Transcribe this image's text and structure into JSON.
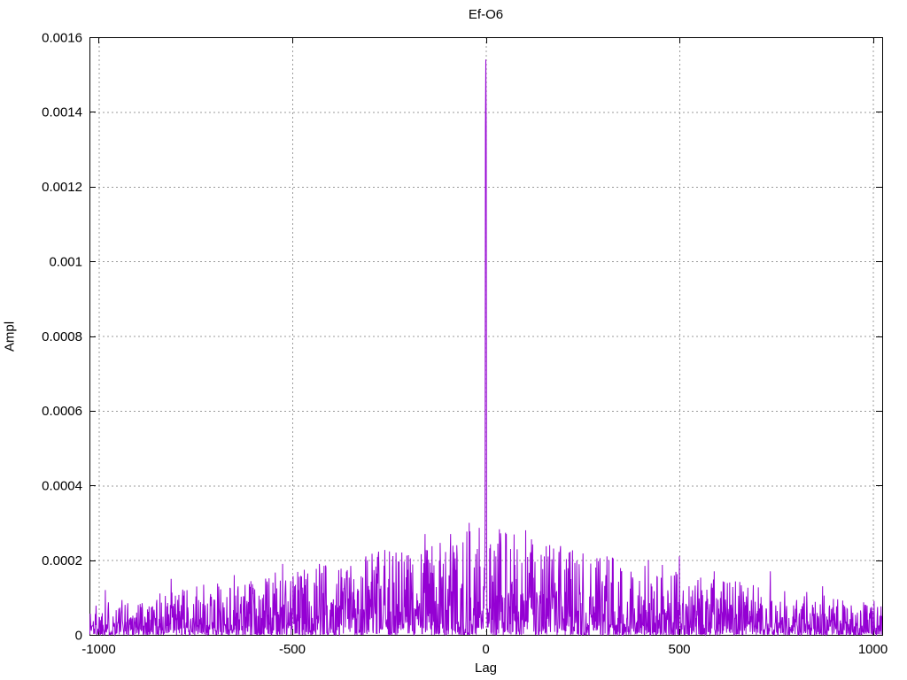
{
  "window": {
    "background": "#ffffff"
  },
  "chart_data": {
    "type": "line",
    "title": "Ef-O6",
    "xlabel": "Lag",
    "ylabel": "Ampl",
    "xlim": [
      -1024,
      1024
    ],
    "ylim": [
      0,
      0.0016
    ],
    "x_ticks": [
      {
        "value": -1000,
        "label": "-1000"
      },
      {
        "value": -500,
        "label": "-500"
      },
      {
        "value": 0,
        "label": "0"
      },
      {
        "value": 500,
        "label": "500"
      },
      {
        "value": 1000,
        "label": "1000"
      }
    ],
    "y_ticks": [
      {
        "value": 0,
        "label": "0"
      },
      {
        "value": 0.0002,
        "label": "0.0002"
      },
      {
        "value": 0.0004,
        "label": "0.0004"
      },
      {
        "value": 0.0006,
        "label": "0.0006"
      },
      {
        "value": 0.0008,
        "label": "0.0008"
      },
      {
        "value": 0.001,
        "label": "0.001"
      },
      {
        "value": 0.0012,
        "label": "0.0012"
      },
      {
        "value": 0.0014,
        "label": "0.0014"
      },
      {
        "value": 0.0016,
        "label": "0.0016"
      }
    ],
    "grid": {
      "visible": true,
      "color": "#9b9b9b",
      "style": "dashed"
    },
    "legend": null,
    "border_color": "#000000",
    "text_color": "#000000",
    "line_color": "#9400d3",
    "main_peak": {
      "lag": 0,
      "amplitude": 0.00154,
      "shoulder_amplitude": 0.00136
    },
    "peak_region": [
      [
        -2,
        0.0003
      ],
      [
        -1,
        0.00136
      ],
      [
        0,
        0.00154
      ],
      [
        1,
        0.00136
      ],
      [
        2,
        0.0003
      ],
      [
        3,
        5e-05
      ],
      [
        4,
        2e-05
      ],
      [
        5,
        7e-05
      ],
      [
        6,
        2e-05
      ],
      [
        7,
        6e-05
      ],
      [
        -3,
        0.00012
      ],
      [
        -4,
        0.00018
      ],
      [
        -5,
        7e-05
      ],
      [
        -6,
        0.00013
      ]
    ],
    "notable_spikes": [
      [
        -983,
        0.00012
      ],
      [
        -813,
        0.00015
      ],
      [
        -650,
        0.00016
      ],
      [
        -525,
        0.00019
      ],
      [
        -430,
        0.00019
      ],
      [
        -310,
        0.00021
      ],
      [
        -232,
        0.00022
      ],
      [
        -157,
        0.00027
      ],
      [
        -91,
        0.00027
      ],
      [
        -43,
        0.0003
      ],
      [
        26,
        0.00021
      ],
      [
        53,
        0.00027
      ],
      [
        64,
        0.00023
      ],
      [
        103,
        0.00028
      ],
      [
        151,
        0.00021
      ],
      [
        215,
        0.00022
      ],
      [
        313,
        0.00021
      ],
      [
        420,
        0.0002
      ],
      [
        500,
        0.00021
      ],
      [
        590,
        0.00017
      ],
      [
        735,
        0.00017
      ],
      [
        870,
        0.00013
      ]
    ],
    "noise": {
      "seed": 1337,
      "lag_min": -1024,
      "lag_max": 1023,
      "sparseness_exponent": 2.2,
      "envelope": [
        [
          0,
          0.0003
        ],
        [
          50,
          0.00028
        ],
        [
          100,
          0.00026
        ],
        [
          200,
          0.00024
        ],
        [
          300,
          0.00022
        ],
        [
          400,
          0.0002
        ],
        [
          500,
          0.00018
        ],
        [
          600,
          0.00015
        ],
        [
          700,
          0.00014
        ],
        [
          800,
          0.00012
        ],
        [
          900,
          0.000105
        ],
        [
          1024,
          9e-05
        ]
      ]
    }
  }
}
